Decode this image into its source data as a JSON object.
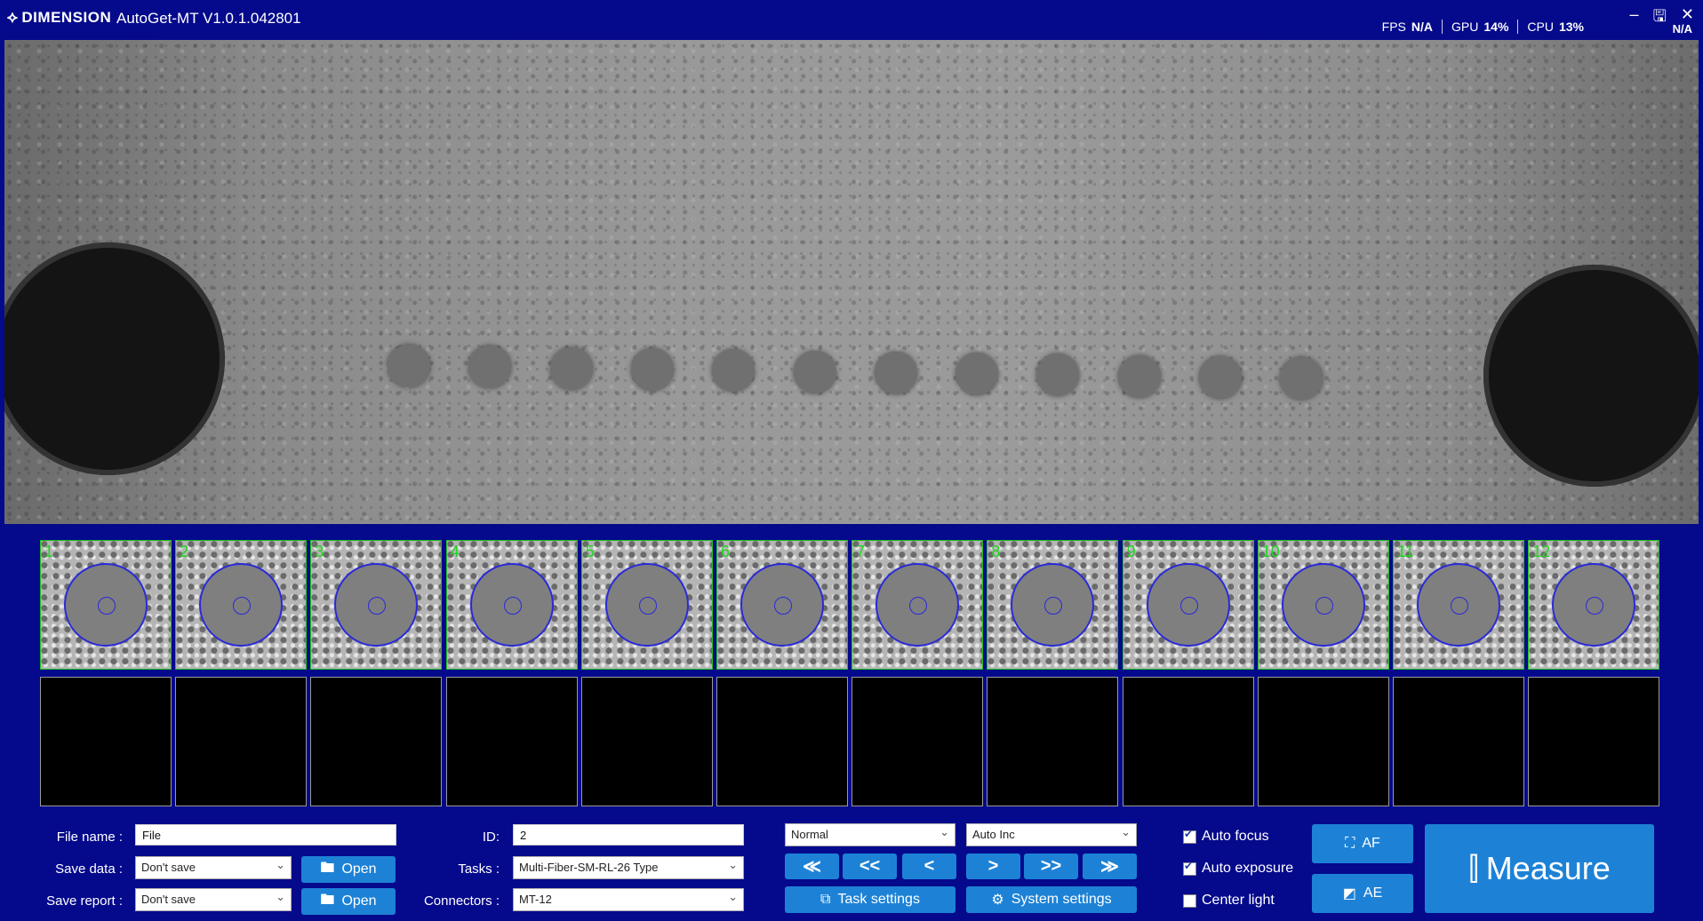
{
  "titlebar": {
    "logo": "DIMENSION",
    "title": "AutoGet-MT V1.0.1.042801",
    "stats": [
      {
        "label": "FPS",
        "value": "N/A"
      },
      {
        "label": "GPU",
        "value": "14%"
      },
      {
        "label": "CPU",
        "value": "13%"
      }
    ],
    "na_badge": "N/A"
  },
  "thumbnails": [
    {
      "num": "1"
    },
    {
      "num": "2"
    },
    {
      "num": "3"
    },
    {
      "num": "4"
    },
    {
      "num": "5"
    },
    {
      "num": "6"
    },
    {
      "num": "7"
    },
    {
      "num": "8"
    },
    {
      "num": "9"
    },
    {
      "num": "10"
    },
    {
      "num": "11"
    },
    {
      "num": "12"
    }
  ],
  "form": {
    "file_name_label": "File name :",
    "file_name_value": "File",
    "save_data_label": "Save data :",
    "save_data_value": "Don't save",
    "save_report_label": "Save report :",
    "save_report_value": "Don't save",
    "open_label": "Open",
    "id_label": "ID:",
    "id_value": "2",
    "tasks_label": "Tasks :",
    "tasks_value": "Multi-Fiber-SM-RL-26 Type",
    "connectors_label": "Connectors :",
    "connectors_value": "MT-12",
    "mode_value": "Normal",
    "increment_value": "Auto Inc"
  },
  "nav": {
    "first": "≪",
    "prev_page": "<<",
    "prev": "<",
    "next": ">",
    "next_page": ">>",
    "last": "≫"
  },
  "settings": {
    "task_settings": "Task settings",
    "system_settings": "System settings"
  },
  "options": {
    "auto_focus": "Auto focus",
    "auto_exposure": "Auto exposure",
    "center_light": "Center light",
    "auto_focus_checked": true,
    "auto_exposure_checked": true,
    "center_light_checked": false
  },
  "actions": {
    "af": "AF",
    "ae": "AE",
    "measure": "Measure"
  },
  "colors": {
    "background": "#050a8c",
    "button": "#1d82d6",
    "thumb_border": "#1ec21e",
    "fiber_ring": "#2a2ad8"
  }
}
